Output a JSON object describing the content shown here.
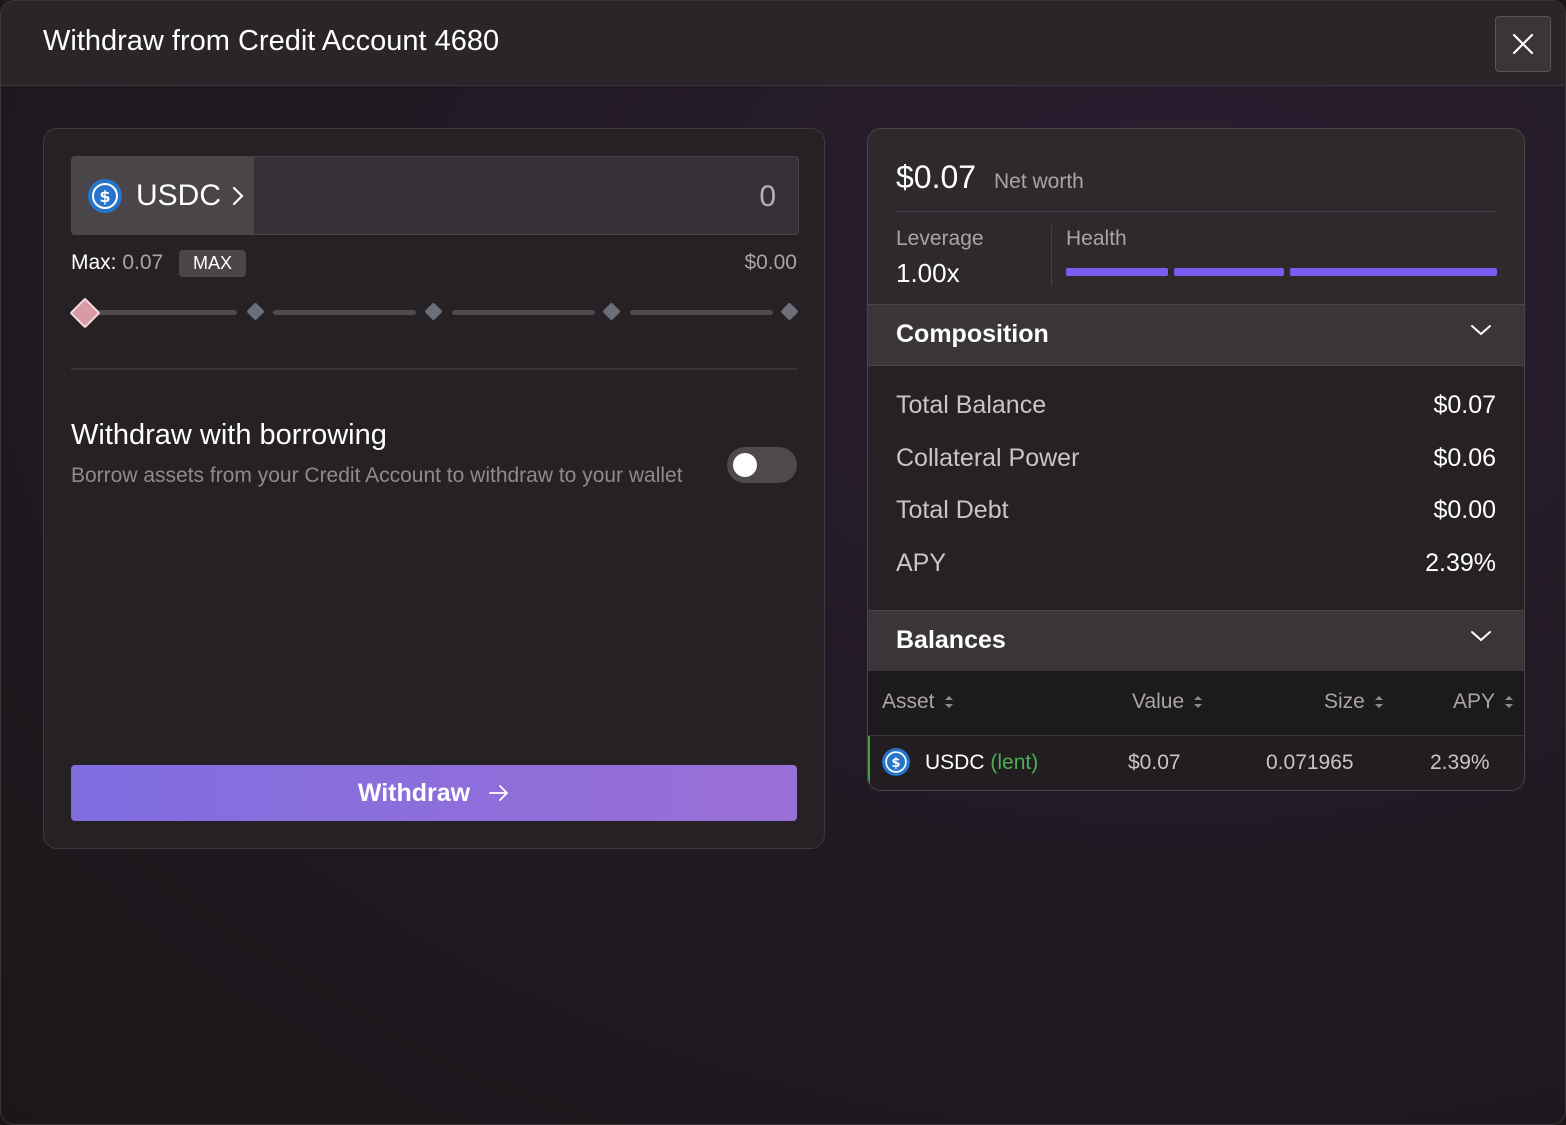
{
  "modal": {
    "title": "Withdraw from Credit Account 4680"
  },
  "withdraw_form": {
    "asset_symbol": "USDC",
    "amount_value": "0",
    "max_label": "Max:",
    "max_value": "0.07",
    "max_button": "MAX",
    "usd_value": "$0.00",
    "slider_fraction": 0,
    "borrow_title": "Withdraw with borrowing",
    "borrow_description": "Borrow assets from your Credit Account to withdraw to your wallet",
    "borrow_enabled": false,
    "submit_label": "Withdraw"
  },
  "summary": {
    "net_worth": "$0.07",
    "net_worth_label": "Net worth",
    "leverage_label": "Leverage",
    "leverage_value": "1.00x",
    "health_label": "Health",
    "health_color": "#7b5ef0"
  },
  "composition": {
    "title": "Composition",
    "rows": [
      {
        "label": "Total Balance",
        "value": "$0.07"
      },
      {
        "label": "Collateral Power",
        "value": "$0.06"
      },
      {
        "label": "Total Debt",
        "value": "$0.00"
      },
      {
        "label": "APY",
        "value": "2.39%"
      }
    ]
  },
  "balances": {
    "title": "Balances",
    "columns": [
      "Asset",
      "Value",
      "Size",
      "APY"
    ],
    "rows": [
      {
        "asset": "USDC",
        "tag": "(lent)",
        "value": "$0.07",
        "size": "0.071965",
        "apy": "2.39%"
      }
    ]
  },
  "colors": {
    "accent": "#7f6de0",
    "usdc_blue": "#2775ca",
    "lent_green": "#4caf50"
  },
  "icons": [
    "close-icon",
    "usdc-coin-icon",
    "chevron-right-icon",
    "arrow-right-icon",
    "chevron-down-icon",
    "sort-icon"
  ]
}
